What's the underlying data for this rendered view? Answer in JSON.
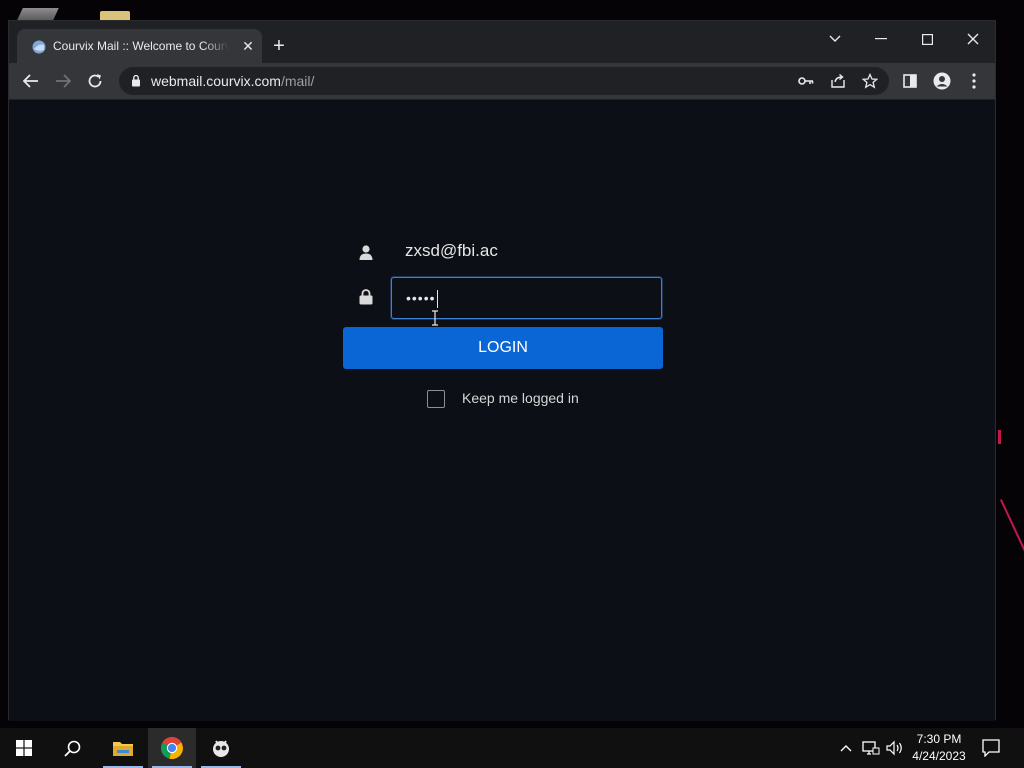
{
  "browser": {
    "tab_title": "Courvix Mail :: Welcome to Courvix Mail",
    "tab_close": "✕",
    "new_tab": "+",
    "url_host": "webmail.courvix.com",
    "url_path": "/mail/"
  },
  "login": {
    "username": "zxsd@fbi.ac",
    "password_masked": "•••••",
    "login_button": "LOGIN",
    "remember_label": "Keep me logged in",
    "remember_checked": false
  },
  "taskbar": {
    "time": "7:30 PM",
    "date": "4/24/2023"
  },
  "colors": {
    "page_bg": "#0c0f16",
    "accent": "#0a66d4",
    "input_border": "#3f7fd6"
  }
}
